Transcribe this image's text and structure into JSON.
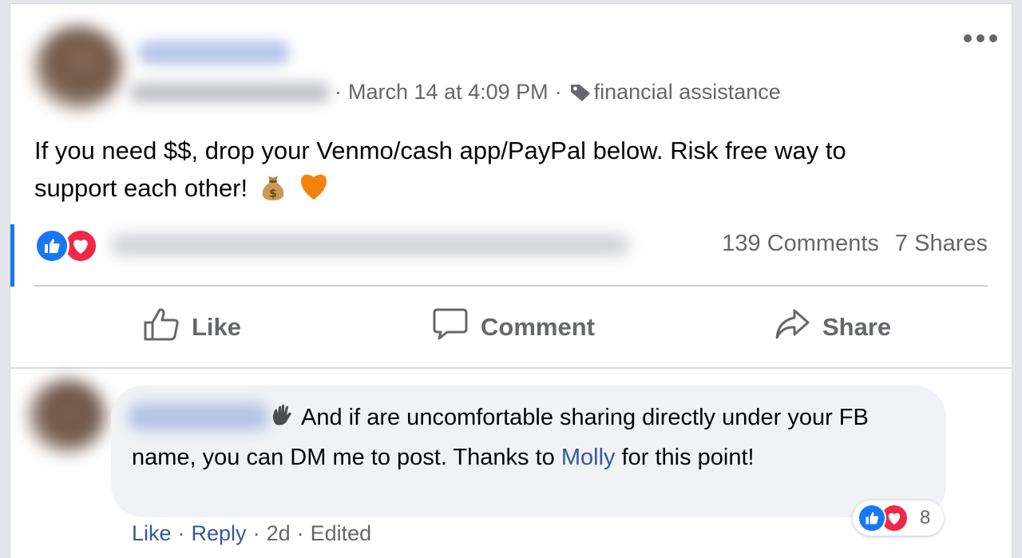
{
  "post": {
    "timestamp": "March 14 at 4:09 PM",
    "separator": "·",
    "tag_label": "financial assistance",
    "text_line1": "If you need $$, drop your Venmo/cash app/PayPal below. Risk free way to",
    "text_line2": "support each other!",
    "emojis": [
      "money-bag",
      "orange-heart"
    ]
  },
  "stats": {
    "comments": "139 Comments",
    "shares": "7 Shares"
  },
  "actions": {
    "like": "Like",
    "comment": "Comment",
    "share": "Share"
  },
  "comment": {
    "text_part1": "And if are uncomfortable sharing directly under your FB name, you can DM me to post. Thanks to",
    "mention": "Molly",
    "text_part2": "for this point!",
    "reaction_count": "8",
    "footer": {
      "like": "Like",
      "reply": "Reply",
      "age": "2d",
      "edited": "Edited",
      "separator": "·"
    }
  },
  "colors": {
    "accent": "#1877f2",
    "love": "#f02849",
    "link": "#385898",
    "muted": "#65676b"
  }
}
